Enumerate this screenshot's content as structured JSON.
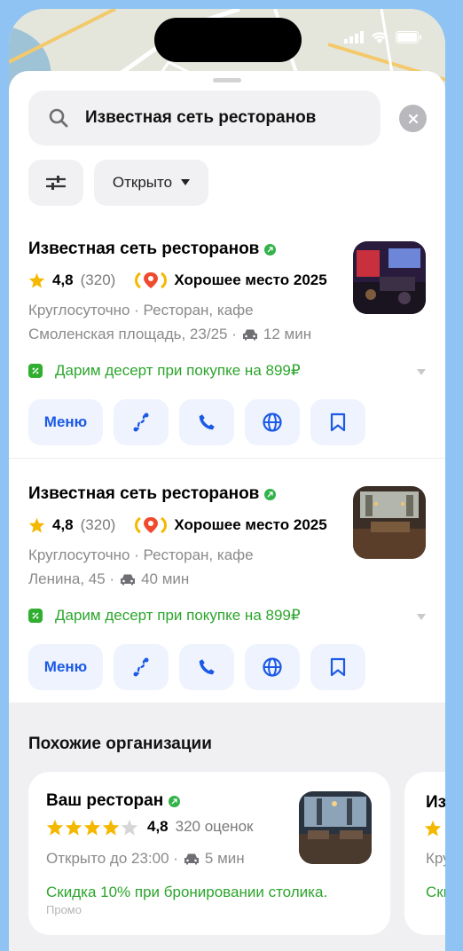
{
  "status_bar": {
    "signal_icon": "signal-icon",
    "wifi_icon": "wifi-icon",
    "battery_icon": "battery-icon"
  },
  "search": {
    "query": "Известная сеть ресторанов"
  },
  "filters": {
    "open_label": "Открыто"
  },
  "results": [
    {
      "name": "Известная сеть ресторанов",
      "rating": "4,8",
      "reviews": "(320)",
      "award": "Хорошее место 2025",
      "hours_category": "Круглосуточно · Ресторан, кафе",
      "address": "Смоленская площадь, 23/25 ·",
      "drive_time": "12 мин",
      "promo": "Дарим десерт при покупке на 899₽",
      "menu_label": "Меню"
    },
    {
      "name": "Известная сеть ресторанов",
      "rating": "4,8",
      "reviews": "(320)",
      "award": "Хорошее место 2025",
      "hours_category": "Круглосуточно · Ресторан, кафе",
      "address": "Ленина, 45 ·",
      "drive_time": "40 мин",
      "promo": "Дарим десерт при покупке на 899₽",
      "menu_label": "Меню"
    }
  ],
  "similar": {
    "title": "Похожие организации",
    "cards": [
      {
        "name": "Ваш ресторан",
        "rating": "4,8",
        "stars": 4,
        "reviews": "320 оценок",
        "hours": "Открыто до 23:00 ·",
        "drive_time": "5 мин",
        "promo": "Скидка 10% при бронировании столика.",
        "promo_tag": "Промо"
      },
      {
        "name": "Из",
        "hours": "Кру",
        "promo": "Ски"
      }
    ]
  },
  "colors": {
    "accent": "#1b59e6",
    "promo_green": "#2ca52c",
    "star": "#f5b800",
    "background": "#8ec3f3"
  }
}
